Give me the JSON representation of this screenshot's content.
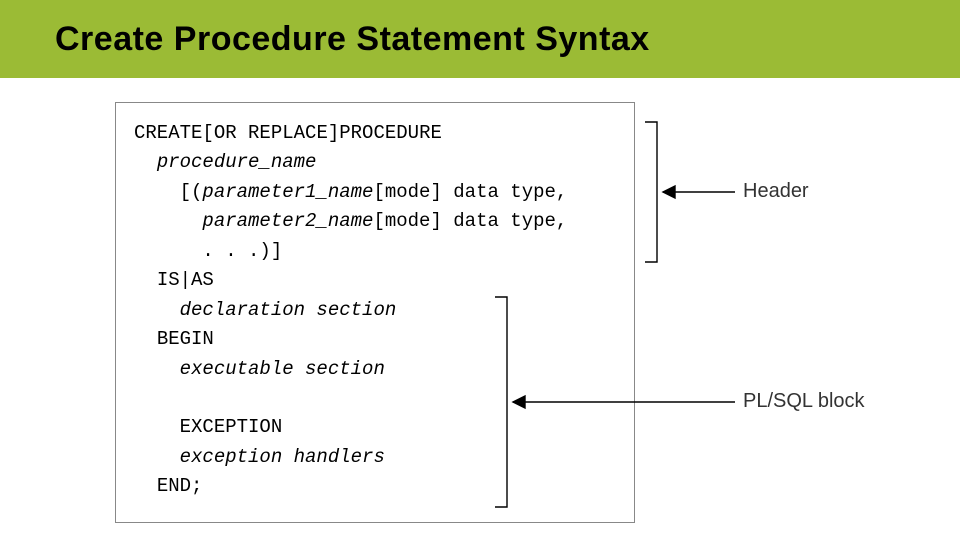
{
  "title": "Create Procedure Statement Syntax",
  "code": {
    "l1a": "CREATE",
    "l1b": "[OR REPLACE]",
    "l1c": "PROCEDURE",
    "l2": "procedure_name",
    "l3a": "[(",
    "l3b": "parameter1_name",
    "l3c": "[mode]",
    "l3d": " data type,",
    "l4b": "parameter2_name",
    "l4c": "[mode]",
    "l4d": " data type,",
    "l5": ". . .)]",
    "l6": "IS|AS",
    "l7": "declaration section",
    "l8": "BEGIN",
    "l9": "executable section",
    "l10": "EXCEPTION",
    "l11": "exception handlers",
    "l12": "END;"
  },
  "labels": {
    "header": "Header",
    "body": "PL/SQL block"
  }
}
